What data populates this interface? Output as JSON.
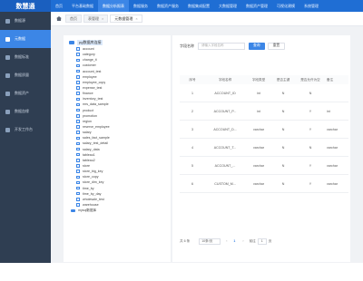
{
  "app": {
    "logo": "数慧通"
  },
  "topnav": [
    "首页",
    "平台基础数据",
    "数据分析报表",
    "数据服务",
    "数据资产服务",
    "数据集成配置",
    "大数据管理",
    "数据资产管理",
    "可视化建模",
    "系统管理"
  ],
  "sidebar": [
    "数据源",
    "元数据",
    "数据标准",
    "数据质量",
    "数据资产",
    "数据血缘",
    "开发工作台"
  ],
  "tabs": [
    {
      "label": "首页"
    },
    {
      "label": "表管理",
      "close": "×"
    },
    {
      "label": "元数据管理",
      "close": "×"
    }
  ],
  "tree": {
    "root": "pg数据库连接",
    "items": [
      "account",
      "category",
      "change_it",
      "customer",
      "account_test",
      "employee",
      "employee_copy",
      "expense_test",
      "finance",
      "inventory_test",
      "mrs_data_sample",
      "product",
      "promotion",
      "region",
      "reserve_employee",
      "salary",
      "sales_fact_sample",
      "salary_test_detail",
      "salary_data",
      "tableau1",
      "tableau2",
      "store",
      "store_big_key",
      "store_copy",
      "store_dim_key",
      "time_by",
      "time_by_day",
      "wholesale_test",
      "warehouse"
    ],
    "bottom": "mysql数据库"
  },
  "search": {
    "label": "字段名称",
    "placeholder": "请输入字段名称",
    "search_btn": "查询",
    "reset_btn": "重置"
  },
  "table": {
    "headers": [
      "序号",
      "字段名称",
      "字段类型",
      "是否主键",
      "是否允许为空",
      "备注"
    ],
    "rows": [
      [
        "1",
        "ACCOUNT_ID",
        "int",
        "N",
        "N",
        ""
      ],
      [
        "2",
        "ACCOUNT_P...",
        "int",
        "N",
        "Y",
        "int"
      ],
      [
        "3",
        "ACCOUNT_D...",
        "varchar",
        "N",
        "Y",
        "varchar"
      ],
      [
        "4",
        "ACCOUNT_T...",
        "varchar",
        "N",
        "N",
        "varchar"
      ],
      [
        "5",
        "ACCOUNT_...",
        "varchar",
        "N",
        "Y",
        "varchar"
      ],
      [
        "6",
        "CUSTOM_M...",
        "varchar",
        "N",
        "Y",
        "varchar"
      ]
    ]
  },
  "pager": {
    "total": "共 6 条",
    "size": "10条/页",
    "prev": "‹",
    "current": "1",
    "next": "›",
    "goto": "前往",
    "goto_value": "1",
    "unit": "页"
  }
}
